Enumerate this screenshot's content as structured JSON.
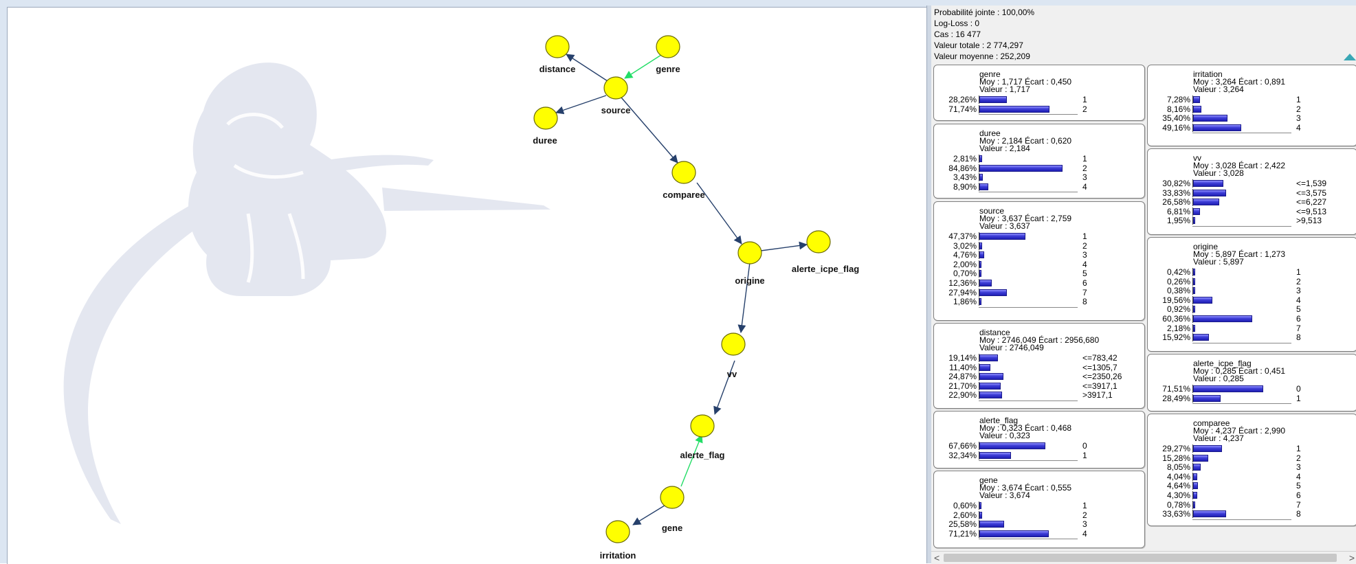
{
  "summary": {
    "joint_probability": "Probabilité jointe : 100,00%",
    "log_loss": "Log-Loss : 0",
    "cases": "Cas : 16 477",
    "total_value": "Valeur totale : 2 774,297",
    "mean_value": "Valeur moyenne : 252,209"
  },
  "graph": {
    "nodes": {
      "distance": "distance",
      "genre": "genre",
      "source": "source",
      "duree": "duree",
      "comparee": "comparee",
      "origine": "origine",
      "alerte_icpe_flag": "alerte_icpe_flag",
      "vv": "vv",
      "alerte_flag": "alerte_flag",
      "gene": "gene",
      "irritation": "irritation"
    },
    "node_color": "#ffff00",
    "arc_color": "#26406b",
    "highlight_arc_color": "#22dd66"
  },
  "monitors": {
    "genre": {
      "name": "genre",
      "stats": "Moy : 1,717 Écart : 0,450",
      "value": "Valeur : 1,717",
      "states": [
        {
          "pct": "28,26%",
          "p": 28.26,
          "label": "1"
        },
        {
          "pct": "71,74%",
          "p": 71.74,
          "label": "2"
        }
      ]
    },
    "duree": {
      "name": "duree",
      "stats": "Moy : 2,184 Écart : 0,620",
      "value": "Valeur : 2,184",
      "states": [
        {
          "pct": "2,81%",
          "p": 2.81,
          "label": "1"
        },
        {
          "pct": "84,86%",
          "p": 84.86,
          "label": "2"
        },
        {
          "pct": "3,43%",
          "p": 3.43,
          "label": "3"
        },
        {
          "pct": "8,90%",
          "p": 8.9,
          "label": "4"
        }
      ]
    },
    "source": {
      "name": "source",
      "stats": "Moy : 3,637 Écart : 2,759",
      "value": "Valeur : 3,637",
      "states": [
        {
          "pct": "47,37%",
          "p": 47.37,
          "label": "1"
        },
        {
          "pct": "3,02%",
          "p": 3.02,
          "label": "2"
        },
        {
          "pct": "4,76%",
          "p": 4.76,
          "label": "3"
        },
        {
          "pct": "2,00%",
          "p": 2.0,
          "label": "4"
        },
        {
          "pct": "0,70%",
          "p": 0.7,
          "label": "5"
        },
        {
          "pct": "12,36%",
          "p": 12.36,
          "label": "6"
        },
        {
          "pct": "27,94%",
          "p": 27.94,
          "label": "7"
        },
        {
          "pct": "1,86%",
          "p": 1.86,
          "label": "8"
        }
      ]
    },
    "distance": {
      "name": "distance",
      "stats": "Moy : 2746,049 Écart : 2956,680",
      "value": "Valeur : 2746,049",
      "states": [
        {
          "pct": "19,14%",
          "p": 19.14,
          "label": "<=783,42"
        },
        {
          "pct": "11,40%",
          "p": 11.4,
          "label": "<=1305,7"
        },
        {
          "pct": "24,87%",
          "p": 24.87,
          "label": "<=2350,26"
        },
        {
          "pct": "21,70%",
          "p": 21.7,
          "label": "<=3917,1"
        },
        {
          "pct": "22,90%",
          "p": 22.9,
          "label": ">3917,1"
        }
      ]
    },
    "alerte_flag": {
      "name": "alerte_flag",
      "stats": "Moy : 0,323 Écart : 0,468",
      "value": "Valeur : 0,323",
      "states": [
        {
          "pct": "67,66%",
          "p": 67.66,
          "label": "0"
        },
        {
          "pct": "32,34%",
          "p": 32.34,
          "label": "1"
        }
      ]
    },
    "gene": {
      "name": "gene",
      "stats": "Moy : 3,674 Écart : 0,555",
      "value": "Valeur : 3,674",
      "states": [
        {
          "pct": "0,60%",
          "p": 0.6,
          "label": "1"
        },
        {
          "pct": "2,60%",
          "p": 2.6,
          "label": "2"
        },
        {
          "pct": "25,58%",
          "p": 25.58,
          "label": "3"
        },
        {
          "pct": "71,21%",
          "p": 71.21,
          "label": "4"
        }
      ]
    },
    "irritation": {
      "name": "irritation",
      "stats": "Moy : 3,264 Écart : 0,891",
      "value": "Valeur : 3,264",
      "states": [
        {
          "pct": "7,28%",
          "p": 7.28,
          "label": "1"
        },
        {
          "pct": "8,16%",
          "p": 8.16,
          "label": "2"
        },
        {
          "pct": "35,40%",
          "p": 35.4,
          "label": "3"
        },
        {
          "pct": "49,16%",
          "p": 49.16,
          "label": "4"
        }
      ]
    },
    "vv": {
      "name": "vv",
      "stats": "Moy : 3,028 Écart : 2,422",
      "value": "Valeur : 3,028",
      "states": [
        {
          "pct": "30,82%",
          "p": 30.82,
          "label": "<=1,539"
        },
        {
          "pct": "33,83%",
          "p": 33.83,
          "label": "<=3,575"
        },
        {
          "pct": "26,58%",
          "p": 26.58,
          "label": "<=6,227"
        },
        {
          "pct": "6,81%",
          "p": 6.81,
          "label": "<=9,513"
        },
        {
          "pct": "1,95%",
          "p": 1.95,
          "label": ">9,513"
        }
      ]
    },
    "origine": {
      "name": "origine",
      "stats": "Moy : 5,897 Écart : 1,273",
      "value": "Valeur : 5,897",
      "states": [
        {
          "pct": "0,42%",
          "p": 0.42,
          "label": "1"
        },
        {
          "pct": "0,26%",
          "p": 0.26,
          "label": "2"
        },
        {
          "pct": "0,38%",
          "p": 0.38,
          "label": "3"
        },
        {
          "pct": "19,56%",
          "p": 19.56,
          "label": "4"
        },
        {
          "pct": "0,92%",
          "p": 0.92,
          "label": "5"
        },
        {
          "pct": "60,36%",
          "p": 60.36,
          "label": "6"
        },
        {
          "pct": "2,18%",
          "p": 2.18,
          "label": "7"
        },
        {
          "pct": "15,92%",
          "p": 15.92,
          "label": "8"
        }
      ]
    },
    "alerte_icpe_flag": {
      "name": "alerte_icpe_flag",
      "stats": "Moy : 0,285 Écart : 0,451",
      "value": "Valeur : 0,285",
      "states": [
        {
          "pct": "71,51%",
          "p": 71.51,
          "label": "0"
        },
        {
          "pct": "28,49%",
          "p": 28.49,
          "label": "1"
        }
      ]
    },
    "comparee": {
      "name": "comparee",
      "stats": "Moy : 4,237 Écart : 2,990",
      "value": "Valeur : 4,237",
      "states": [
        {
          "pct": "29,27%",
          "p": 29.27,
          "label": "1"
        },
        {
          "pct": "15,28%",
          "p": 15.28,
          "label": "2"
        },
        {
          "pct": "8,05%",
          "p": 8.05,
          "label": "3"
        },
        {
          "pct": "4,04%",
          "p": 4.04,
          "label": "4"
        },
        {
          "pct": "4,64%",
          "p": 4.64,
          "label": "5"
        },
        {
          "pct": "4,30%",
          "p": 4.3,
          "label": "6"
        },
        {
          "pct": "0,78%",
          "p": 0.78,
          "label": "7"
        },
        {
          "pct": "33,63%",
          "p": 33.63,
          "label": "8"
        }
      ]
    }
  },
  "scrollbar": {
    "left_arrow": "<",
    "right_arrow": ">"
  }
}
